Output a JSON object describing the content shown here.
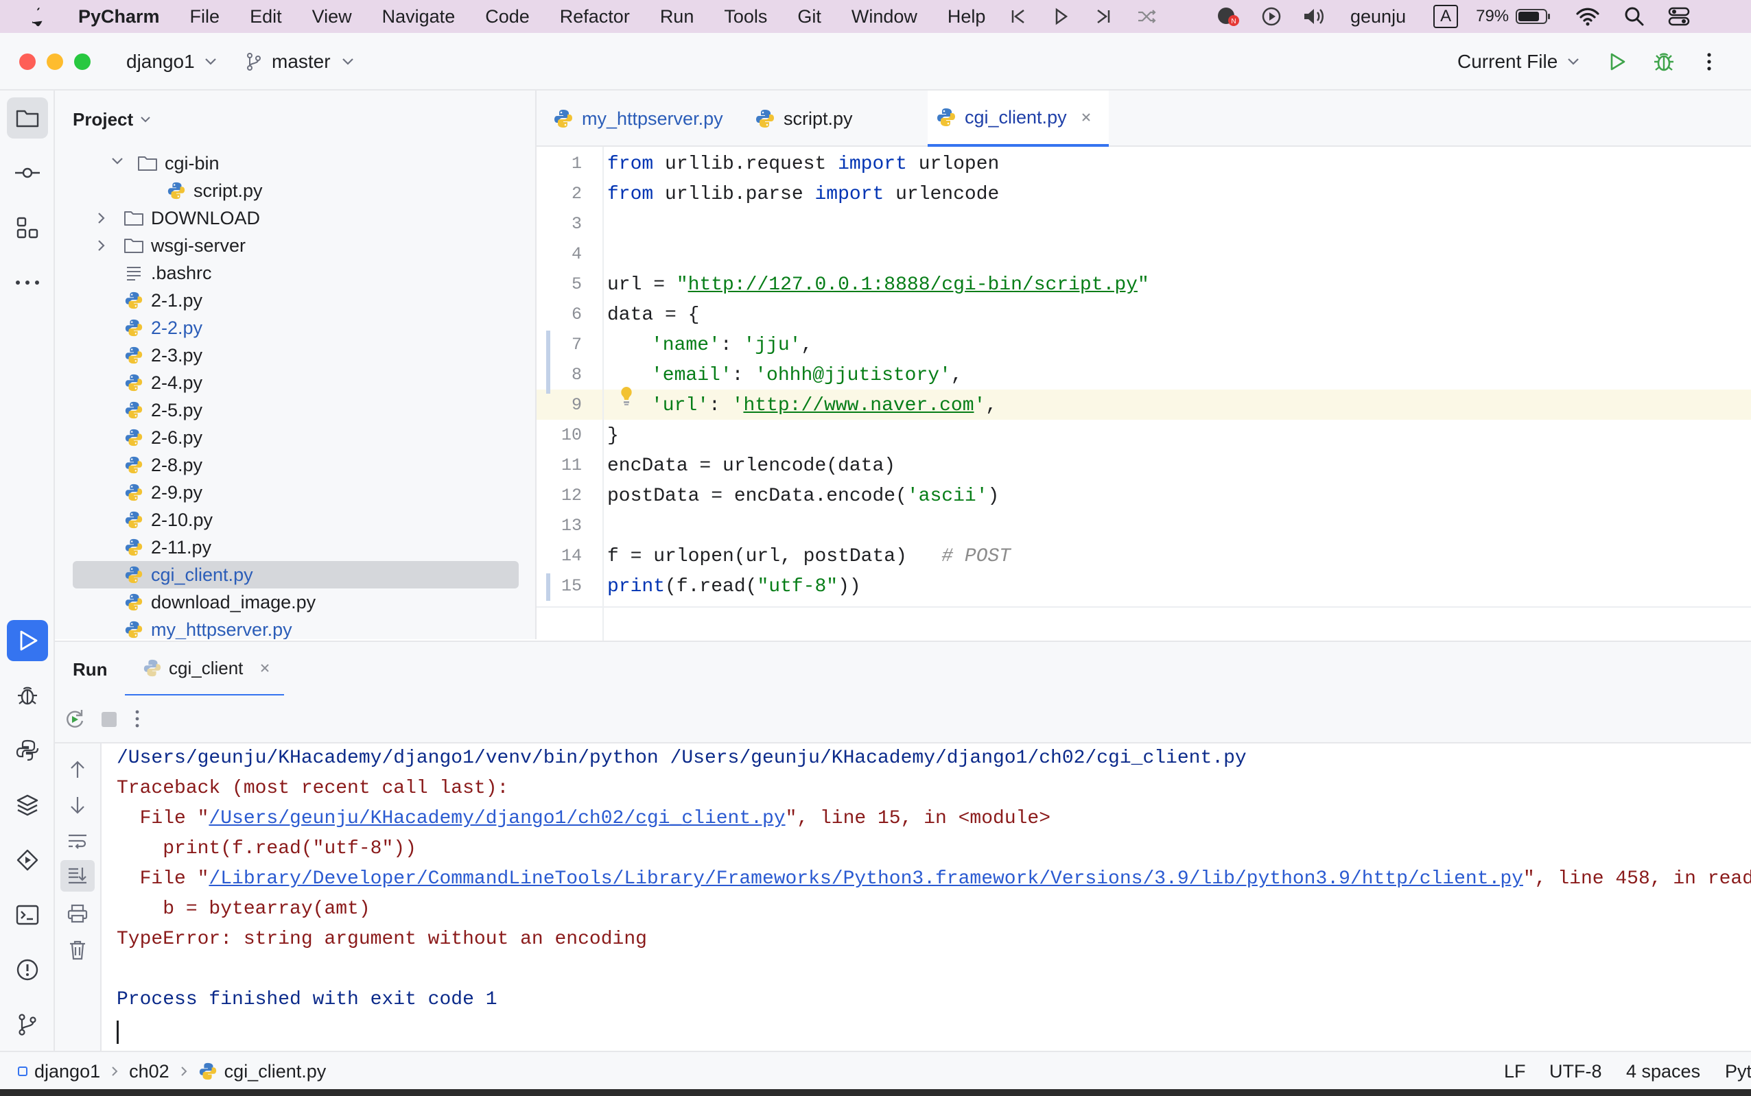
{
  "menubar": {
    "app": "PyCharm",
    "items": [
      "File",
      "Edit",
      "View",
      "Navigate",
      "Code",
      "Refactor",
      "Run",
      "Tools",
      "Git",
      "Window",
      "Help"
    ],
    "user": "geunju",
    "input_source": "A",
    "battery": "79%"
  },
  "titlebar": {
    "project": "django1",
    "branch": "master",
    "run_config": "Current File"
  },
  "project_panel": {
    "title": "Project",
    "tree": [
      {
        "label": "cgi-bin",
        "kind": "folder",
        "expanded": true
      },
      {
        "label": "script.py",
        "kind": "py"
      },
      {
        "label": "DOWNLOAD",
        "kind": "folder",
        "expanded": false
      },
      {
        "label": "wsgi-server",
        "kind": "folder",
        "expanded": false
      },
      {
        "label": ".bashrc",
        "kind": "text"
      },
      {
        "label": "2-1.py",
        "kind": "py"
      },
      {
        "label": "2-2.py",
        "kind": "py",
        "modified": true
      },
      {
        "label": "2-3.py",
        "kind": "py"
      },
      {
        "label": "2-4.py",
        "kind": "py"
      },
      {
        "label": "2-5.py",
        "kind": "py"
      },
      {
        "label": "2-6.py",
        "kind": "py"
      },
      {
        "label": "2-8.py",
        "kind": "py"
      },
      {
        "label": "2-9.py",
        "kind": "py"
      },
      {
        "label": "2-10.py",
        "kind": "py"
      },
      {
        "label": "2-11.py",
        "kind": "py"
      },
      {
        "label": "cgi_client.py",
        "kind": "py",
        "selected": true
      },
      {
        "label": "download_image.py",
        "kind": "py"
      },
      {
        "label": "my_httpserver.py",
        "kind": "py",
        "modified": true
      }
    ]
  },
  "editor": {
    "tabs": [
      {
        "label": "my_httpserver.py",
        "active": false
      },
      {
        "label": "script.py",
        "active": false
      },
      {
        "label": "cgi_client.py",
        "active": true
      }
    ],
    "line_numbers": [
      "1",
      "2",
      "3",
      "4",
      "5",
      "6",
      "7",
      "8",
      "9",
      "10",
      "11",
      "12",
      "13",
      "14",
      "15"
    ],
    "code": {
      "l1": {
        "k1": "from",
        "t1": " urllib.request ",
        "k2": "import",
        "t2": " urlopen"
      },
      "l2": {
        "k1": "from",
        "t1": " urllib.parse ",
        "k2": "import",
        "t2": " urlencode"
      },
      "l5": {
        "t1": "url = ",
        "q1": "\"",
        "link": "http://127.0.0.1:8888/cgi-bin/script.py",
        "q2": "\""
      },
      "l6": "data = {",
      "l7": {
        "s1": "'name'",
        "t1": ": ",
        "s2": "'jju'",
        "t2": ","
      },
      "l8": {
        "s1": "'email'",
        "t1": ": ",
        "s2": "'ohhh@jjutistory'",
        "t2": ","
      },
      "l9": {
        "s1": "'url'",
        "t1": ": ",
        "q1": "'",
        "link": "http://www.naver.com",
        "q2": "'",
        "t2": ","
      },
      "l10": "}",
      "l11": "encData = urlencode(data)",
      "l12": {
        "t1": "postData = encData.encode(",
        "s1": "'ascii'",
        "t2": ")"
      },
      "l14": {
        "t1": "f = urlopen(url, postData)   ",
        "c1": "# POST"
      },
      "l15": {
        "k1": "print",
        "t1": "(f.read(",
        "s1": "\"utf-8\"",
        "t2": "))"
      }
    }
  },
  "run_panel": {
    "title": "Run",
    "tab": "cgi_client",
    "console": {
      "c1": "/Users/geunju/KHacademy/django1/venv/bin/python /Users/geunju/KHacademy/django1/ch02/cgi_client.py",
      "c2": "Traceback (most recent call last):",
      "c3": {
        "pre": "  File \"",
        "link": "/Users/geunju/KHacademy/django1/ch02/cgi_client.py",
        "post": "\", line 15, in <module>"
      },
      "c4": "    print(f.read(\"utf-8\"))",
      "c5": {
        "pre": "  File \"",
        "link": "/Library/Developer/CommandLineTools/Library/Frameworks/Python3.framework/Versions/3.9/lib/python3.9/http/client.py",
        "post": "\", line 458, in read"
      },
      "c6": "    b = bytearray(amt)",
      "c7": "TypeError: string argument without an encoding",
      "c9": "Process finished with exit code 1"
    }
  },
  "statusbar": {
    "crumbs": [
      "django1",
      "ch02",
      "cgi_client.py"
    ],
    "line_sep": "LF",
    "encoding": "UTF-8",
    "indent": "4 spaces",
    "interpreter": "Pyt"
  }
}
